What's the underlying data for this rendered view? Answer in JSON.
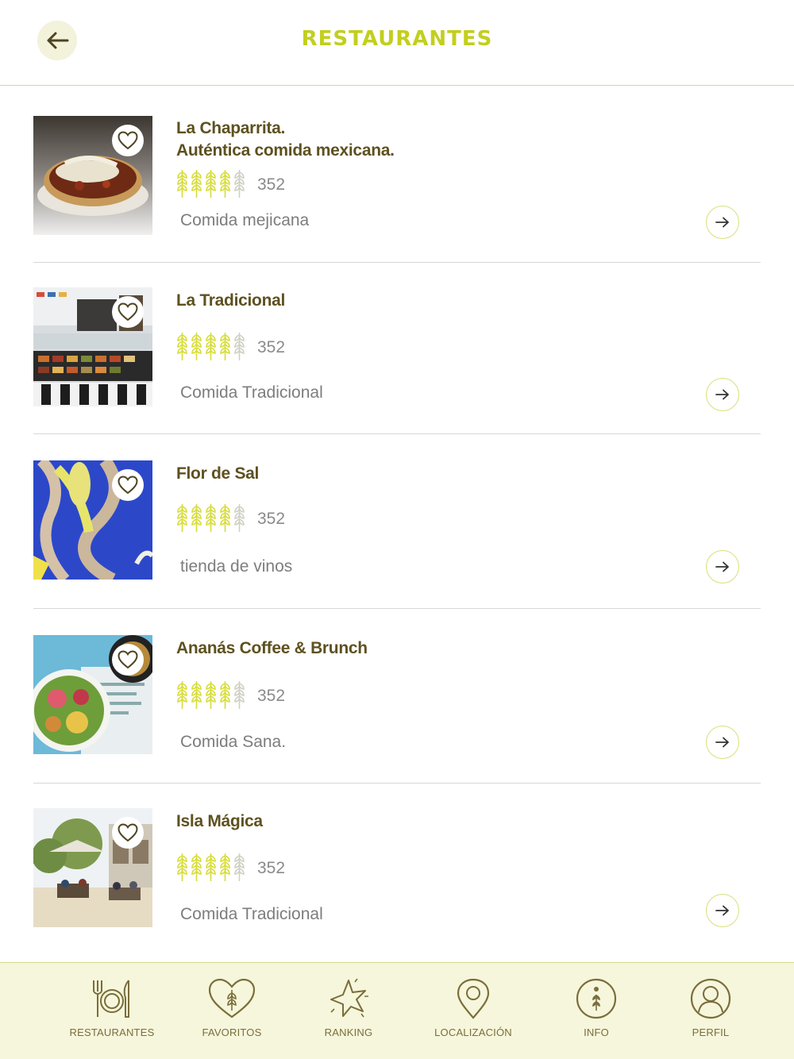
{
  "header": {
    "title": "RESTAURANTES",
    "back_icon": "arrow-left-icon"
  },
  "restaurants": [
    {
      "name_line1": "La Chaparrita.",
      "name_line2": "Auténtica comida mexicana.",
      "rating_wheats": 4.5,
      "count": "352",
      "category": "Comida mejicana",
      "image": "tostada-photo"
    },
    {
      "name_line1": "La Tradicional",
      "name_line2": "",
      "rating_wheats": 4.5,
      "count": "352",
      "category": "Comida Tradicional",
      "image": "deli-counter-photo"
    },
    {
      "name_line1": "Flor de Sal",
      "name_line2": "",
      "rating_wheats": 4.5,
      "count": "352",
      "category": "tienda de vinos",
      "image": "blue-mural-photo"
    },
    {
      "name_line1": "Ananás Coffee & Brunch",
      "name_line2": "",
      "rating_wheats": 4.5,
      "count": "352",
      "category": "Comida Sana.",
      "image": "poke-bowl-photo"
    },
    {
      "name_line1": "Isla Mágica",
      "name_line2": "",
      "rating_wheats": 4.5,
      "count": "352",
      "category": "Comida Tradicional",
      "image": "terrace-photo"
    }
  ],
  "tabbar": {
    "items": [
      {
        "label": "RESTAURANTES",
        "icon": "plate-cutlery-icon"
      },
      {
        "label": "FAVORITOS",
        "icon": "heart-wheat-icon"
      },
      {
        "label": "RANKING",
        "icon": "star-icon"
      },
      {
        "label": "LOCALIZACIÓN",
        "icon": "location-pin-icon"
      },
      {
        "label": "INFO",
        "icon": "info-wheat-icon"
      },
      {
        "label": "PERFIL",
        "icon": "user-icon"
      }
    ]
  },
  "colors": {
    "accent": "#c2cf1e",
    "text_dark": "#5e5120",
    "muted": "#7d7d7d",
    "tabbar_bg": "#f6f6dc",
    "back_bg": "#f3f2da"
  }
}
